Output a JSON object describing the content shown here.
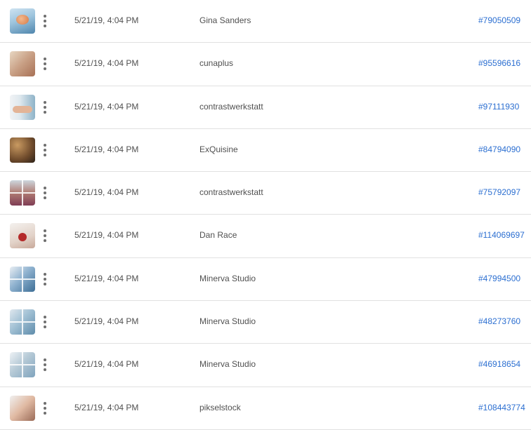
{
  "rows": [
    {
      "date": "5/21/19, 4:04 PM",
      "author": "Gina Sanders",
      "asset_id": "#79050509",
      "thumbnail": "photo-thumbnail"
    },
    {
      "date": "5/21/19, 4:04 PM",
      "author": "cunaplus",
      "asset_id": "#95596616",
      "thumbnail": "photo-thumbnail"
    },
    {
      "date": "5/21/19, 4:04 PM",
      "author": "contrastwerkstatt",
      "asset_id": "#97111930",
      "thumbnail": "photo-thumbnail"
    },
    {
      "date": "5/21/19, 4:04 PM",
      "author": "ExQuisine",
      "asset_id": "#84794090",
      "thumbnail": "photo-thumbnail"
    },
    {
      "date": "5/21/19, 4:04 PM",
      "author": "contrastwerkstatt",
      "asset_id": "#75792097",
      "thumbnail": "photo-thumbnail"
    },
    {
      "date": "5/21/19, 4:04 PM",
      "author": "Dan Race",
      "asset_id": "#114069697",
      "thumbnail": "photo-thumbnail"
    },
    {
      "date": "5/21/19, 4:04 PM",
      "author": "Minerva Studio",
      "asset_id": "#47994500",
      "thumbnail": "collage-thumbnail"
    },
    {
      "date": "5/21/19, 4:04 PM",
      "author": "Minerva Studio",
      "asset_id": "#48273760",
      "thumbnail": "collage-thumbnail"
    },
    {
      "date": "5/21/19, 4:04 PM",
      "author": "Minerva Studio",
      "asset_id": "#46918654",
      "thumbnail": "collage-thumbnail"
    },
    {
      "date": "5/21/19, 4:04 PM",
      "author": "pikselstock",
      "asset_id": "#108443774",
      "thumbnail": "photo-thumbnail"
    }
  ],
  "icons": {
    "more_actions": "more-vertical-icon"
  },
  "colors": {
    "link": "#2c6fd1",
    "text": "#505050",
    "divider": "#e1e1e1"
  }
}
